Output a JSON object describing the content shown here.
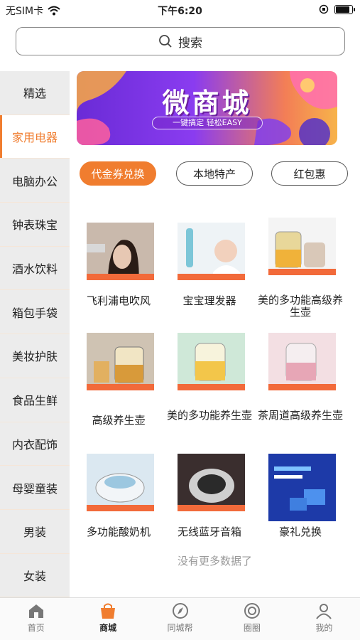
{
  "status_bar": {
    "carrier": "无SIM卡",
    "time": "下午6:20"
  },
  "search": {
    "placeholder": "搜索",
    "icon": "search-icon"
  },
  "categories": [
    {
      "label": "精选",
      "active": false
    },
    {
      "label": "家用电器",
      "active": true
    },
    {
      "label": "电脑办公",
      "active": false
    },
    {
      "label": "钟表珠宝",
      "active": false
    },
    {
      "label": "酒水饮料",
      "active": false
    },
    {
      "label": "箱包手袋",
      "active": false
    },
    {
      "label": "美妆护肤",
      "active": false
    },
    {
      "label": "食品生鲜",
      "active": false
    },
    {
      "label": "内衣配饰",
      "active": false
    },
    {
      "label": "母婴童装",
      "active": false
    },
    {
      "label": "男装",
      "active": false
    },
    {
      "label": "女装",
      "active": false
    }
  ],
  "banner": {
    "title": "微商城",
    "subtitle": "一键搞定 轻松EASY"
  },
  "filters": [
    {
      "label": "代金券兑换",
      "active": true
    },
    {
      "label": "本地特产",
      "active": false
    },
    {
      "label": "红包惠",
      "active": false
    }
  ],
  "products": [
    {
      "name": "飞利浦电吹风"
    },
    {
      "name": "宝宝理发器"
    },
    {
      "name": "美的多功能高级养生壶"
    },
    {
      "name": "高级养生壶"
    },
    {
      "name": "美的多功能养生壶"
    },
    {
      "name": "茶周道高级养生壶"
    },
    {
      "name": "多功能酸奶机"
    },
    {
      "name": "无线蓝牙音箱"
    },
    {
      "name": "豪礼兑换"
    }
  ],
  "no_more_text": "没有更多数据了",
  "tabbar": [
    {
      "label": "首页",
      "icon": "home-icon",
      "active": false
    },
    {
      "label": "商城",
      "icon": "shopping-bag-icon",
      "active": true
    },
    {
      "label": "同城帮",
      "icon": "compass-icon",
      "active": false
    },
    {
      "label": "圈圈",
      "icon": "circle-icon",
      "active": false
    },
    {
      "label": "我的",
      "icon": "user-icon",
      "active": false
    }
  ],
  "colors": {
    "accent": "#f07d2f",
    "sidebar_bg": "#ececec"
  }
}
